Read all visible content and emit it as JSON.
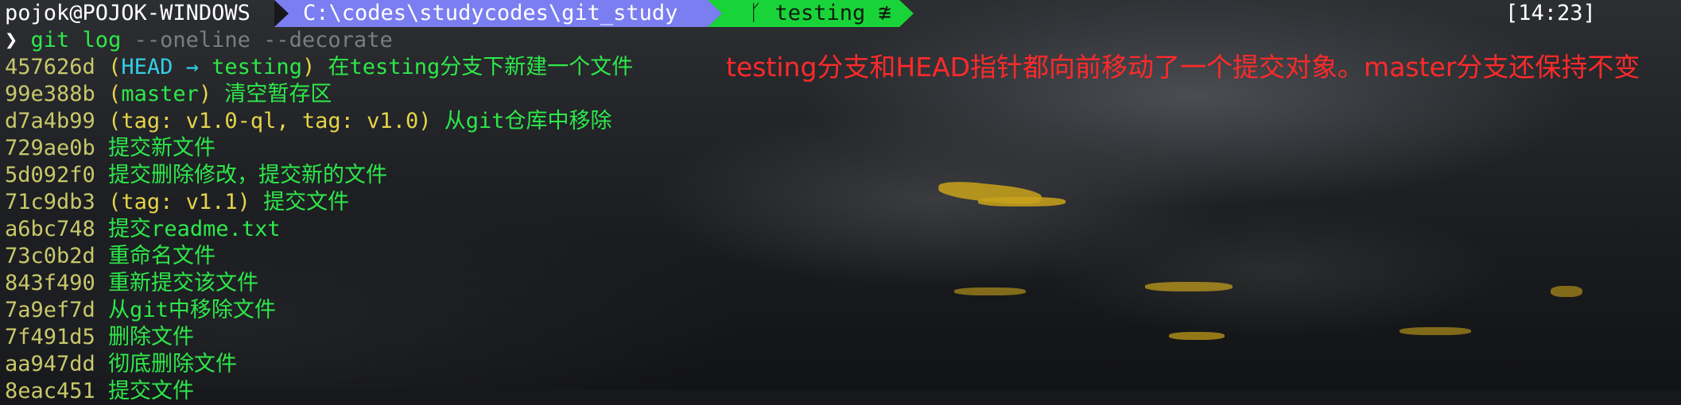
{
  "prompt": {
    "user_host": "pojok@POJOK-WINDOWS",
    "path": "C:\\codes\\studycodes\\git_study",
    "branch_icon": "git-branch-icon",
    "branch": "testing",
    "branch_status": "≇",
    "clock": "[14:23]"
  },
  "command": {
    "prompt_symbol": "❯",
    "cmd": "git log",
    "args": "--oneline --decorate"
  },
  "log": [
    {
      "hash": "457626d",
      "ref_open": "(",
      "head": "HEAD",
      "arrow": "→",
      "branch": "testing",
      "ref_close": ")",
      "msg": "在testing分支下新建一个文件"
    },
    {
      "hash": "99e388b",
      "ref_open": "(",
      "branch": "master",
      "ref_close": ")",
      "msg": "清空暂存区"
    },
    {
      "hash": "d7a4b99",
      "ref_open": "(",
      "tags": "tag: v1.0-ql, tag: v1.0",
      "ref_close": ")",
      "msg": "从git仓库中移除"
    },
    {
      "hash": "729ae0b",
      "msg": "提交新文件"
    },
    {
      "hash": "5d092f0",
      "msg": "提交删除修改，提交新的文件"
    },
    {
      "hash": "71c9db3",
      "ref_open": "(",
      "tags": "tag: v1.1",
      "ref_close": ")",
      "msg": "提交文件"
    },
    {
      "hash": "a6bc748",
      "msg": "提交readme.txt"
    },
    {
      "hash": "73c0b2d",
      "msg": "重命名文件"
    },
    {
      "hash": "843f490",
      "msg": "重新提交该文件"
    },
    {
      "hash": "7a9ef7d",
      "msg": "从git中移除文件"
    },
    {
      "hash": "7f491d5",
      "msg": "删除文件"
    },
    {
      "hash": "aa947dd",
      "msg": "彻底删除文件"
    },
    {
      "hash": "8eac451",
      "msg": "提交文件"
    }
  ],
  "annotation": "testing分支和HEAD指针都向前移动了一个提交对象。master分支还保持不变",
  "colors": {
    "path_bg": "#7b7ef0",
    "branch_bg": "#19d439",
    "log_text": "#2ee84a",
    "ref_head": "#32cfe6",
    "annotation": "#ff2a2a"
  }
}
